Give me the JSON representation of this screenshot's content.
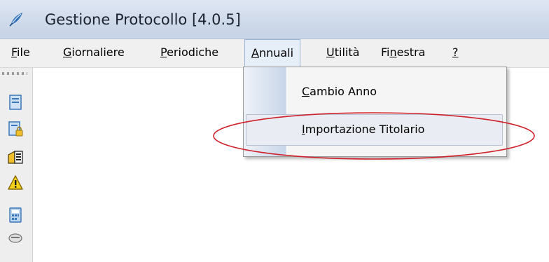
{
  "window": {
    "title": "Gestione Protocollo [4.0.5]"
  },
  "menubar": {
    "items": [
      {
        "id": "file",
        "pre": "",
        "ul": "F",
        "post": "ile"
      },
      {
        "id": "giornaliere",
        "pre": "",
        "ul": "G",
        "post": "iornaliere"
      },
      {
        "id": "periodiche",
        "pre": "",
        "ul": "P",
        "post": "eriodiche"
      },
      {
        "id": "annuali",
        "pre": "",
        "ul": "A",
        "post": "nnuali"
      },
      {
        "id": "utilita",
        "pre": "",
        "ul": "U",
        "post": "tilità"
      },
      {
        "id": "finestra",
        "pre": "Fi",
        "ul": "n",
        "post": "estra"
      },
      {
        "id": "help",
        "pre": "",
        "ul": "?",
        "post": ""
      }
    ],
    "active_item": "Annuali"
  },
  "dropdown": {
    "items": [
      {
        "pre": "",
        "ul": "C",
        "post": "ambio Anno"
      },
      {
        "pre": "",
        "ul": "I",
        "post": "mportazione Titolario"
      }
    ],
    "highlighted_item": "Importazione Titolario"
  },
  "toolbar": {
    "icons": [
      "document-icon",
      "document-lock-icon",
      "register-icon",
      "warning-icon",
      "calculator-icon",
      "stamp-icon"
    ]
  },
  "colors": {
    "titlebar": "#cfdaea",
    "menubar": "#f0f0f0",
    "highlight_border": "#b9c2d0",
    "annotation_ellipse": "#d0202a"
  }
}
